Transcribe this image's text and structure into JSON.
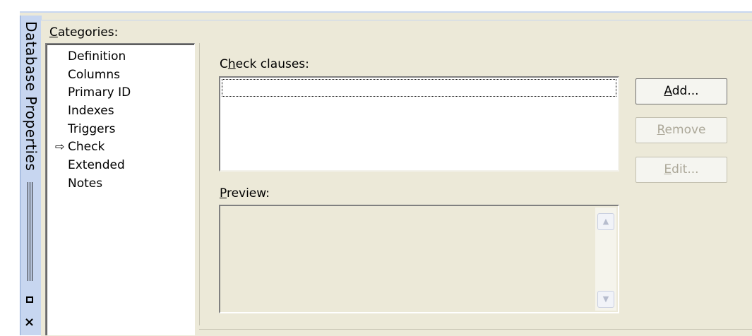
{
  "dock": {
    "title": "Database Properties"
  },
  "categories": {
    "label_accel": "C",
    "label_rest": "ategories:",
    "items": [
      "Definition",
      "Columns",
      "Primary ID",
      "Indexes",
      "Triggers",
      "Check",
      "Extended",
      "Notes"
    ],
    "selected_arrow": "⇨"
  },
  "check_clauses": {
    "label_pre": "C",
    "label_accel": "h",
    "label_rest": "eck clauses:"
  },
  "preview": {
    "label_accel": "P",
    "label_rest": "review:"
  },
  "buttons": {
    "add_accel": "A",
    "add_rest": "dd...",
    "remove_accel": "R",
    "remove_rest": "emove",
    "edit_accel": "E",
    "edit_rest": "dit..."
  },
  "icons": {
    "close": "×",
    "scroll_up": "▲",
    "scroll_down": "▼"
  }
}
